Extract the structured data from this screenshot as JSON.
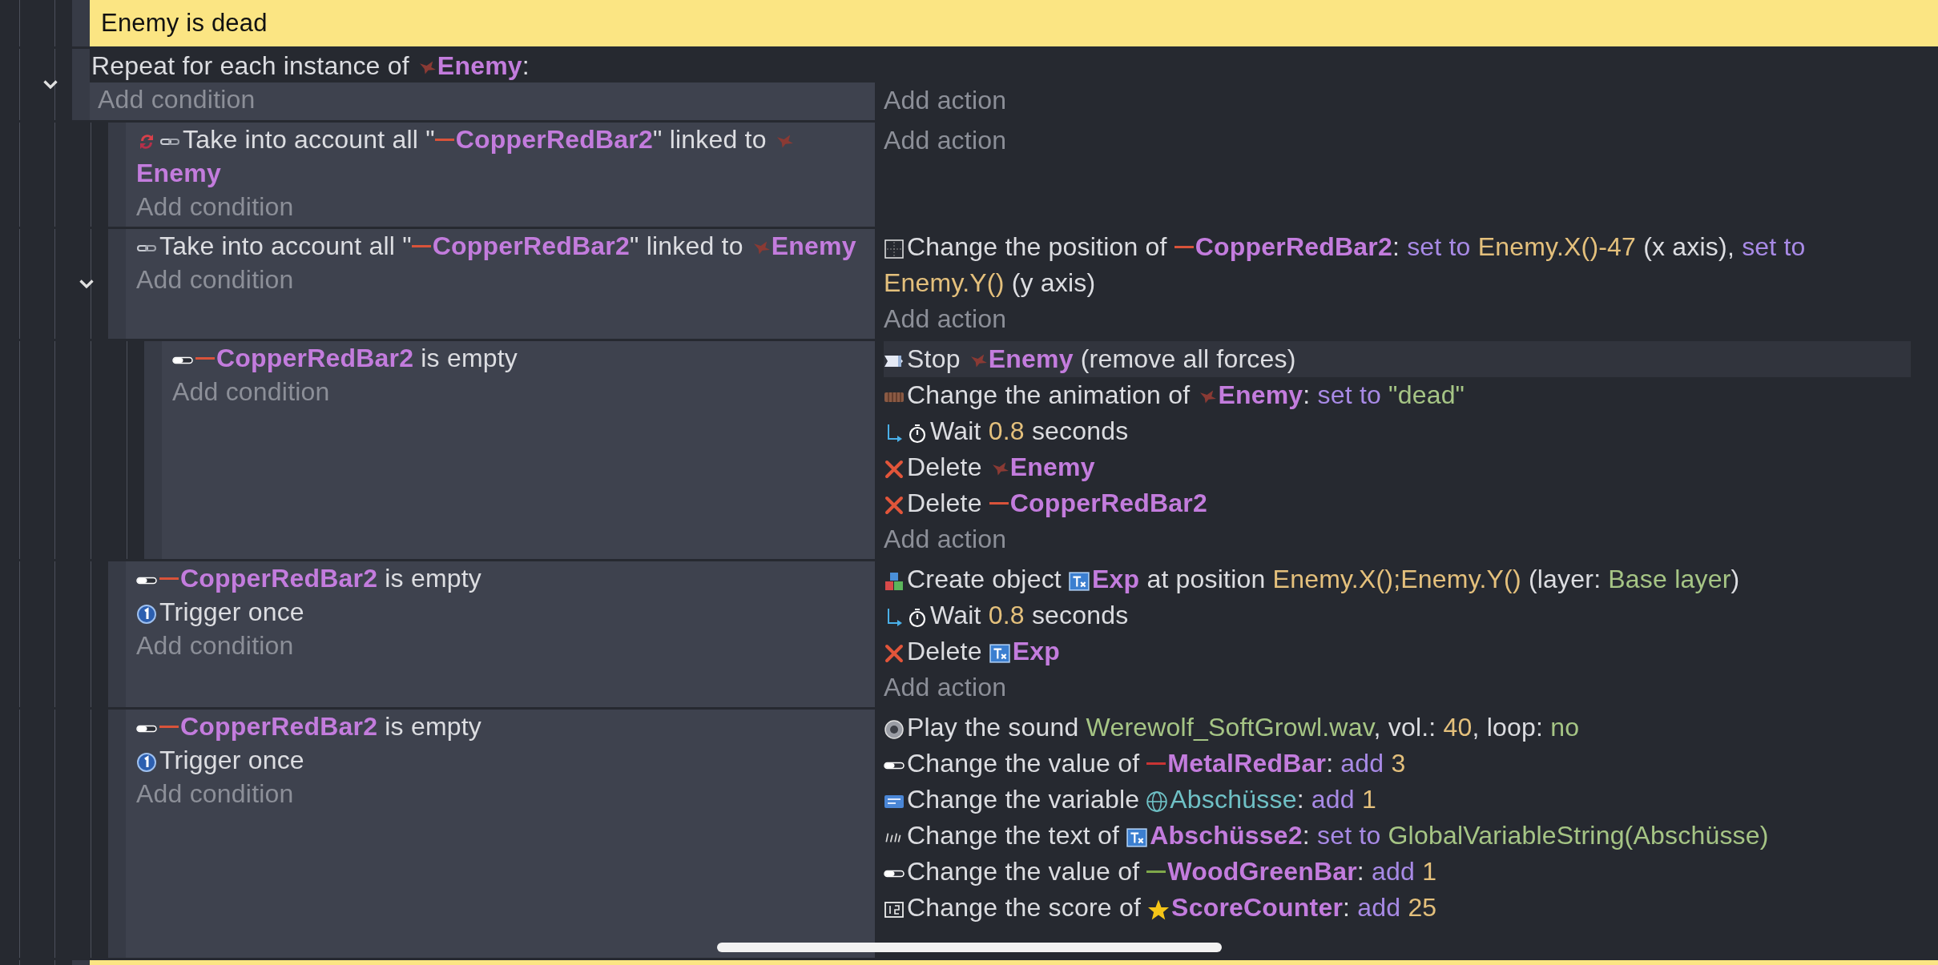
{
  "comment": {
    "text": "Enemy is dead"
  },
  "events": [
    {
      "kind": "repeat",
      "expanded": true,
      "header": [
        {
          "kind": "text",
          "text": "Repeat for each instance of"
        },
        {
          "kind": "sprite",
          "text": "Enemy"
        },
        {
          "kind": "text",
          "text": ":"
        }
      ],
      "add_condition": "Add condition",
      "add_action": "Add action",
      "children": [
        {
          "kind": "standard",
          "conditions": [
            {
              "kind": "linked-repeat",
              "parts": [
                {
                  "kind": "text",
                  "text": "Take into account all \""
                },
                {
                  "kind": "bar",
                  "color": "#d9533a",
                  "text": "CopperRedBar2"
                },
                {
                  "kind": "text",
                  "text": "\" linked to"
                },
                {
                  "kind": "sprite",
                  "text": "Enemy"
                }
              ]
            }
          ],
          "add_condition": "Add condition",
          "add_action": "Add action"
        },
        {
          "kind": "standard",
          "expanded": true,
          "conditions": [
            {
              "kind": "linked",
              "parts": [
                {
                  "kind": "text",
                  "text": "Take into account all \""
                },
                {
                  "kind": "bar",
                  "color": "#d9533a",
                  "text": "CopperRedBar2"
                },
                {
                  "kind": "text",
                  "text": "\" linked to"
                },
                {
                  "kind": "sprite",
                  "text": "Enemy"
                }
              ]
            }
          ],
          "add_condition": "Add condition",
          "actions": [
            {
              "kind": "position",
              "hovered": false,
              "parts": [
                {
                  "kind": "text",
                  "text": "Change the position of"
                },
                {
                  "kind": "bar",
                  "color": "#d9533a",
                  "text": "CopperRedBar2"
                },
                {
                  "kind": "text",
                  "text": ":"
                },
                {
                  "kind": "keyword",
                  "text": "set to"
                },
                {
                  "kind": "number",
                  "text": "Enemy.X()-47"
                },
                {
                  "kind": "text",
                  "text": "(x axis),"
                },
                {
                  "kind": "keyword",
                  "text": "set to"
                },
                {
                  "kind": "number",
                  "text": "Enemy.Y()"
                },
                {
                  "kind": "text",
                  "text": "(y axis)"
                }
              ]
            }
          ],
          "add_action": "Add action",
          "children": [
            {
              "kind": "standard",
              "conditions": [
                {
                  "kind": "empty-check",
                  "parts": [
                    {
                      "kind": "bar",
                      "color": "#d9533a",
                      "text": "CopperRedBar2"
                    },
                    {
                      "kind": "text",
                      "text": "is empty"
                    }
                  ]
                }
              ],
              "add_condition": "Add condition",
              "actions": [
                {
                  "kind": "stop",
                  "hovered": true,
                  "parts": [
                    {
                      "kind": "text",
                      "text": "Stop"
                    },
                    {
                      "kind": "sprite",
                      "text": "Enemy"
                    },
                    {
                      "kind": "text",
                      "text": "(remove all forces)"
                    }
                  ]
                },
                {
                  "kind": "animation",
                  "hovered": false,
                  "parts": [
                    {
                      "kind": "text",
                      "text": "Change the animation of"
                    },
                    {
                      "kind": "sprite",
                      "text": "Enemy"
                    },
                    {
                      "kind": "text",
                      "text": ":"
                    },
                    {
                      "kind": "keyword",
                      "text": "set to"
                    },
                    {
                      "kind": "string",
                      "text": "\"dead\""
                    }
                  ]
                },
                {
                  "kind": "wait",
                  "hovered": false,
                  "parts": [
                    {
                      "kind": "text",
                      "text": "Wait"
                    },
                    {
                      "kind": "number",
                      "text": "0.8"
                    },
                    {
                      "kind": "text",
                      "text": "seconds"
                    }
                  ]
                },
                {
                  "kind": "delete",
                  "hovered": false,
                  "parts": [
                    {
                      "kind": "text",
                      "text": "Delete"
                    },
                    {
                      "kind": "sprite",
                      "text": "Enemy"
                    }
                  ]
                },
                {
                  "kind": "delete",
                  "hovered": false,
                  "parts": [
                    {
                      "kind": "text",
                      "text": "Delete"
                    },
                    {
                      "kind": "bar",
                      "color": "#d9533a",
                      "text": "CopperRedBar2"
                    }
                  ]
                }
              ],
              "add_action": "Add action"
            }
          ]
        },
        {
          "kind": "standard",
          "conditions": [
            {
              "kind": "empty-check",
              "parts": [
                {
                  "kind": "bar",
                  "color": "#d9533a",
                  "text": "CopperRedBar2"
                },
                {
                  "kind": "text",
                  "text": "is empty"
                }
              ]
            },
            {
              "kind": "once",
              "parts": [
                {
                  "kind": "text",
                  "text": "Trigger once"
                }
              ]
            }
          ],
          "add_condition": "Add condition",
          "actions": [
            {
              "kind": "create",
              "hovered": false,
              "parts": [
                {
                  "kind": "text",
                  "text": "Create object"
                },
                {
                  "kind": "text-object",
                  "text": "Exp"
                },
                {
                  "kind": "text",
                  "text": "at position"
                },
                {
                  "kind": "number",
                  "text": "Enemy.X();Enemy.Y()"
                },
                {
                  "kind": "text",
                  "text": "(layer:"
                },
                {
                  "kind": "string",
                  "text": "Base layer"
                },
                {
                  "kind": "text",
                  "text": ")"
                }
              ]
            },
            {
              "kind": "wait",
              "hovered": false,
              "parts": [
                {
                  "kind": "text",
                  "text": "Wait"
                },
                {
                  "kind": "number",
                  "text": "0.8"
                },
                {
                  "kind": "text",
                  "text": "seconds"
                }
              ]
            },
            {
              "kind": "delete",
              "hovered": false,
              "parts": [
                {
                  "kind": "text",
                  "text": "Delete"
                },
                {
                  "kind": "text-object",
                  "text": "Exp"
                }
              ]
            }
          ],
          "add_action": "Add action"
        },
        {
          "kind": "standard",
          "conditions": [
            {
              "kind": "empty-check",
              "parts": [
                {
                  "kind": "bar",
                  "color": "#d9533a",
                  "text": "CopperRedBar2"
                },
                {
                  "kind": "text",
                  "text": "is empty"
                }
              ]
            },
            {
              "kind": "once",
              "parts": [
                {
                  "kind": "text",
                  "text": "Trigger once"
                }
              ]
            }
          ],
          "add_condition": "Add condition",
          "actions": [
            {
              "kind": "sound",
              "hovered": false,
              "parts": [
                {
                  "kind": "text",
                  "text": "Play the sound"
                },
                {
                  "kind": "string",
                  "text": "Werewolf_SoftGrowl.wav"
                },
                {
                  "kind": "text",
                  "text": ", vol.:"
                },
                {
                  "kind": "number",
                  "text": "40"
                },
                {
                  "kind": "text",
                  "text": ", loop:"
                },
                {
                  "kind": "string",
                  "text": "no"
                }
              ]
            },
            {
              "kind": "value",
              "hovered": false,
              "parts": [
                {
                  "kind": "text",
                  "text": "Change the value of"
                },
                {
                  "kind": "bar",
                  "color": "#c93434",
                  "text": "MetalRedBar"
                },
                {
                  "kind": "text",
                  "text": ":"
                },
                {
                  "kind": "keyword",
                  "text": "add"
                },
                {
                  "kind": "number",
                  "text": "3"
                }
              ]
            },
            {
              "kind": "variable",
              "hovered": false,
              "parts": [
                {
                  "kind": "text",
                  "text": "Change the variable"
                },
                {
                  "kind": "global-variable",
                  "text": "Abschüsse"
                },
                {
                  "kind": "text",
                  "text": ":"
                },
                {
                  "kind": "keyword",
                  "text": "add"
                },
                {
                  "kind": "number",
                  "text": "1"
                }
              ]
            },
            {
              "kind": "text",
              "hovered": false,
              "parts": [
                {
                  "kind": "text",
                  "text": "Change the text of"
                },
                {
                  "kind": "text-object",
                  "text": "Abschüsse2"
                },
                {
                  "kind": "text",
                  "text": ":"
                },
                {
                  "kind": "keyword",
                  "text": "set to"
                },
                {
                  "kind": "string",
                  "text": "GlobalVariableString(Abschüsse)"
                }
              ]
            },
            {
              "kind": "value",
              "hovered": false,
              "parts": [
                {
                  "kind": "text",
                  "text": "Change the value of"
                },
                {
                  "kind": "bar",
                  "color": "#7fa84a",
                  "text": "WoodGreenBar"
                },
                {
                  "kind": "text",
                  "text": ":"
                },
                {
                  "kind": "keyword",
                  "text": "add"
                },
                {
                  "kind": "number",
                  "text": "1"
                }
              ]
            },
            {
              "kind": "score",
              "hovered": false,
              "parts": [
                {
                  "kind": "text",
                  "text": "Change the score of"
                },
                {
                  "kind": "counter",
                  "text": "ScoreCounter"
                },
                {
                  "kind": "text",
                  "text": ":"
                },
                {
                  "kind": "keyword",
                  "text": "add"
                },
                {
                  "kind": "number",
                  "text": "25"
                }
              ]
            }
          ]
        }
      ]
    }
  ]
}
